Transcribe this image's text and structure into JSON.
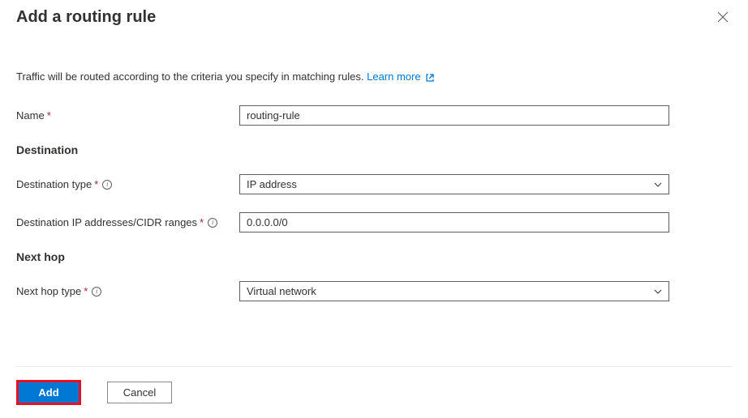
{
  "header": {
    "title": "Add a routing rule"
  },
  "description": {
    "text": "Traffic will be routed according to the criteria you specify in matching rules.",
    "learn_more": "Learn more"
  },
  "form": {
    "name": {
      "label": "Name",
      "value": "routing-rule"
    },
    "destination_section": "Destination",
    "destination_type": {
      "label": "Destination type",
      "value": "IP address"
    },
    "destination_cidr": {
      "label": "Destination IP addresses/CIDR ranges",
      "value": "0.0.0.0/0"
    },
    "next_hop_section": "Next hop",
    "next_hop_type": {
      "label": "Next hop type",
      "value": "Virtual network"
    }
  },
  "footer": {
    "add_label": "Add",
    "cancel_label": "Cancel"
  }
}
